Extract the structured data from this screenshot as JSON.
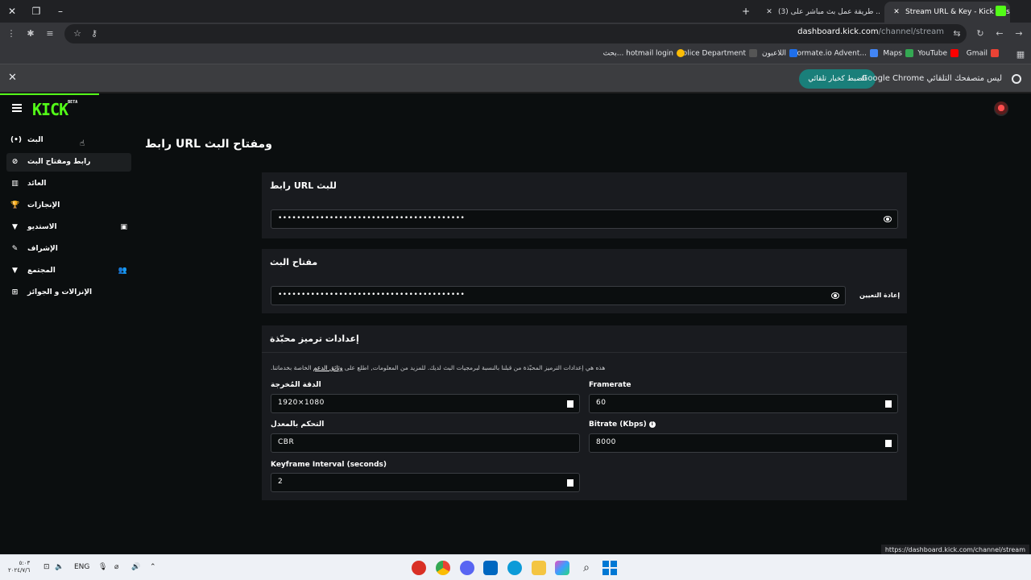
{
  "browser": {
    "tabs": [
      {
        "title": "Stream URL & Key - Kick Dashb",
        "active": true
      },
      {
        "title": "(3) طريقة عمل بث مباشر على ..",
        "active": false
      }
    ],
    "new_tab": "+",
    "url_host": "dashboard.kick.com",
    "url_path": "/channel/stream",
    "bookmarks": [
      "Gmail",
      "YouTube",
      "Maps",
      "Wormate.io Advent...",
      "اللاعبون",
      "Police Department",
      "بحث... hotmail login"
    ],
    "infobar": {
      "message": "Google Chrome ليس متصفحك التلقائي",
      "button": "الضبط كخيار تلقائي",
      "close": "✕"
    },
    "status_url": "https://dashboard.kick.com/channel/stream"
  },
  "kick": {
    "logo": "KICK",
    "logo_badge": "BETA",
    "sidebar": [
      {
        "label": "البث",
        "icon": "(•)"
      },
      {
        "label": "رابط ومفتاح البث",
        "icon": "⊘"
      },
      {
        "label": "العائد",
        "icon": "▥"
      },
      {
        "label": "الإنجازات",
        "icon": "🏆"
      },
      {
        "label": "الاستديو",
        "icon": "▼"
      },
      {
        "label": "الإشراف",
        "icon": "✎"
      },
      {
        "label": "المجتمع",
        "icon": "▼"
      },
      {
        "label": "الإنزالات و الجوائز",
        "icon": "⊞"
      }
    ],
    "page_title": "رابط URL ومفتاح البث",
    "stream_url_card": {
      "title": "رابط URL للبث",
      "value": "••••••••••••••••••••••••••••••••••••••••"
    },
    "stream_key_card": {
      "title": "مفتاح البث",
      "value": "••••••••••••••••••••••••••••••••••••••••",
      "reset": "إعادة التعيين"
    },
    "encoding_card": {
      "title": "إعدادات ترميز محبّذة",
      "description_pre": ".هذه هي إعدادات الترميز المحبّذة من قبلنا بالنسبة لبرمجيات البث لديك. للمزيد من المعلومات, اطلع على ",
      "description_link": "وثائق الدعم",
      "description_post": " الخاصة بخدماتنا",
      "resolution_label": "الدقة المُخرجة",
      "resolution_value": "1920×1080",
      "framerate_label": "Framerate",
      "framerate_value": "60",
      "ratecontrol_label": "التحكم بالمعدل",
      "ratecontrol_value": "CBR",
      "bitrate_label": "Bitrate (Kbps)",
      "bitrate_value": "8000",
      "keyframe_label": "Keyframe Interval (seconds)",
      "keyframe_value": "2"
    }
  },
  "taskbar": {
    "lang": "ENG",
    "clock_time": "٥:٠٣",
    "clock_date": "٢٠٢٤/٧/٦"
  }
}
